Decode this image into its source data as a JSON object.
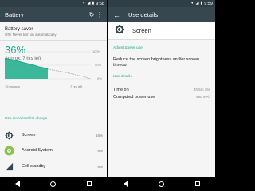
{
  "status": {
    "time": "9:58",
    "time_right": "9:59"
  },
  "left": {
    "title": "Battery",
    "battery_saver_title": "Battery saver",
    "battery_saver_sub": "Off / Never turn on automatically",
    "percent": "36%",
    "approx": "Approx. 7 hrs left",
    "chart_data": {
      "type": "area",
      "y_ticks": [
        "100%",
        "50%",
        "0%"
      ],
      "x_labels": [
        "13 hrs ago",
        "7 hrs left"
      ],
      "history": [
        [
          0,
          75
        ],
        [
          6,
          72
        ],
        [
          12,
          68
        ],
        [
          20,
          61
        ],
        [
          28,
          55
        ],
        [
          34,
          50
        ],
        [
          40,
          44
        ],
        [
          46,
          40
        ],
        [
          50,
          36
        ]
      ],
      "projection": [
        [
          50,
          36
        ],
        [
          70,
          24
        ],
        [
          90,
          10
        ],
        [
          100,
          0
        ]
      ]
    },
    "usage_header": "Use since last full charge",
    "usage": [
      {
        "label": "Screen",
        "value": "16%"
      },
      {
        "label": "Android System",
        "value": "6%"
      },
      {
        "label": "Cell standby",
        "value": "6%"
      }
    ]
  },
  "right": {
    "title": "Use details",
    "item_name": "Screen",
    "adjust": "Adjust power use",
    "reduce": "Reduce the screen brightness and/or screen timeout",
    "details": "Use details",
    "rows": [
      {
        "label": "Time on",
        "value": "4h 5m 36s"
      },
      {
        "label": "Computed power use",
        "value": "490 mAh"
      }
    ]
  },
  "colors": {
    "accent": "#1aab8a",
    "toolbar": "#37474f",
    "statusbar": "#303f46"
  }
}
